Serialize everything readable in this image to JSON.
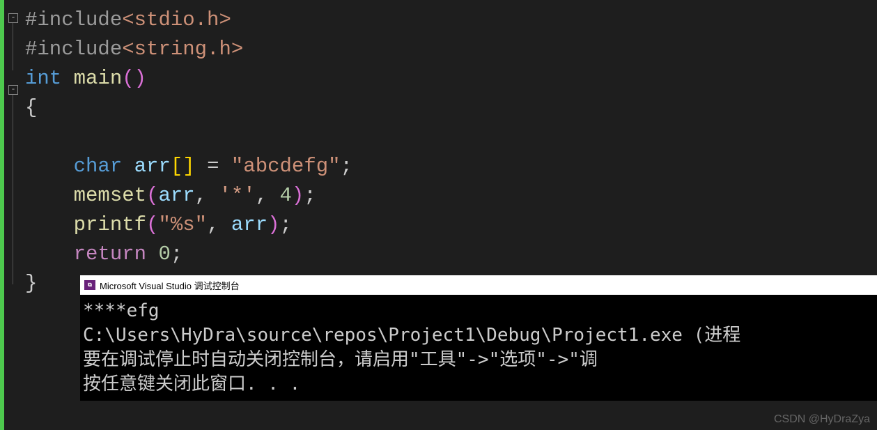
{
  "code": {
    "include1_directive": "#include",
    "include1_header": "<stdio.h>",
    "include2_directive": "#include",
    "include2_header": "<string.h>",
    "int_kw": "int",
    "main_fn": "main",
    "parens": "()",
    "brace_open": "{",
    "char_kw": "char",
    "arr_var": "arr",
    "brackets": "[]",
    "eq": " = ",
    "str_literal": "\"abcdefg\"",
    "semi": ";",
    "memset_fn": "memset",
    "paren_open": "(",
    "arr_ref": "arr",
    "comma1": ", ",
    "char_literal": "'*'",
    "comma2": ", ",
    "num4": "4",
    "paren_close": ")",
    "printf_fn": "printf",
    "fmt_str": "\"%s\"",
    "return_kw": "return",
    "num0": "0",
    "brace_close": "}"
  },
  "fold": {
    "minus1": "-",
    "minus2": "-"
  },
  "console": {
    "title": "Microsoft Visual Studio 调试控制台",
    "icon_text": "",
    "line1": "****efg",
    "line2": "C:\\Users\\HyDra\\source\\repos\\Project1\\Debug\\Project1.exe (进程",
    "line3": "要在调试停止时自动关闭控制台，请启用\"工具\"->\"选项\"->\"调",
    "line4": "按任意键关闭此窗口. . ."
  },
  "watermark": "CSDN @HyDraZya"
}
